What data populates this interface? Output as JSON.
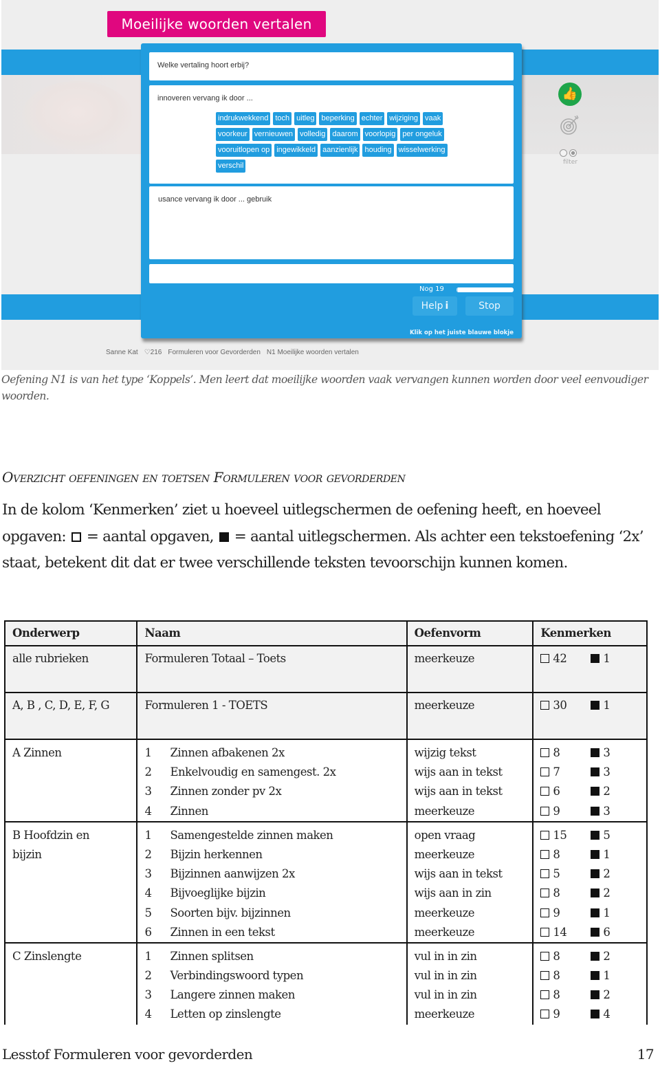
{
  "screenshot": {
    "exercise_title": "Moeilijke woorden vertalen",
    "question": "Welke vertaling hoort erbij?",
    "prompt": "innoveren vervang ik door ...",
    "word_chips": [
      "indrukwekkend",
      "toch",
      "uitleg",
      "beperking",
      "echter",
      "wijziging",
      "vaak",
      "voorkeur",
      "vernieuwen",
      "volledig",
      "daarom",
      "voorlopig",
      "per ongeluk",
      "vooruitlopen op",
      "ingewikkeld",
      "aanzienlijk",
      "houding",
      "wisselwerking",
      "verschil"
    ],
    "previous_answer": "usance vervang ik door ... gebruik",
    "input_value": "",
    "remaining_label": "Nog 19",
    "progress_fraction": 0.02,
    "help_label": "Help",
    "help_icon": "info-icon",
    "stop_label": "Stop",
    "hint": "Klik op het juiste blauwe blokje",
    "side_icons": [
      "thumbs-up-icon",
      "target-icon"
    ],
    "filter_label": "filter",
    "status_bar": {
      "user": "Sanne Kat",
      "hearts": "♡216",
      "course": "Formuleren voor Gevorderden",
      "exercise": "N1 Moeilijke woorden vertalen"
    },
    "colors": {
      "panel_blue": "#219ddf",
      "title_pink": "#e0077f",
      "thumb_green": "#1ea54a"
    }
  },
  "caption": "Oefening N1 is van het type ‘Koppels’. Men leert dat moeilijke woorden vaak vervangen kunnen worden door veel eenvoudiger woorden.",
  "heading": {
    "part1_cap": "O",
    "part1_rest": "verzicht oefeningen en toetsen ",
    "part2_cap": "F",
    "part2_rest": "ormuleren voor gevorderden"
  },
  "intro": {
    "before": "In de kolom ‘Kenmerken’ ziet u hoeveel uitlegschermen de oefening heeft, en hoeveel opgaven: ",
    "open_square_meaning": " = aantal opgaven, ",
    "filled_square_meaning": " = aantal uitlegschermen. Als achter een tekstoefening ‘2x’ staat, betekent dit dat er twee verschillende teksten tevoorschijn kunnen komen."
  },
  "table": {
    "headers": [
      "Onderwerp",
      "Naam",
      "Oefenvorm",
      "Kenmerken"
    ],
    "tests": [
      {
        "onderwerp": "alle rubrieken",
        "naam": "Formuleren Totaal – Toets",
        "oefenvorm": "meerkeuze",
        "opgaven": "42",
        "uitleg": "1"
      },
      {
        "onderwerp": "A, B , C, D, E, F, G",
        "naam": "Formuleren 1 - TOETS",
        "oefenvorm": "meerkeuze",
        "opgaven": "30",
        "uitleg": "1"
      }
    ],
    "groups": [
      {
        "onderwerp": [
          "A Zinnen"
        ],
        "items": [
          {
            "nr": "1",
            "naam": "Zinnen afbakenen 2x",
            "oefenvorm": "wijzig tekst",
            "opgaven": "8",
            "uitleg": "3"
          },
          {
            "nr": "2",
            "naam": "Enkelvoudig en samengest. 2x",
            "oefenvorm": "wijs aan in tekst",
            "opgaven": "7",
            "uitleg": "3"
          },
          {
            "nr": "3",
            "naam": "Zinnen zonder pv 2x",
            "oefenvorm": "wijs aan in tekst",
            "opgaven": "6",
            "uitleg": "2"
          },
          {
            "nr": "4",
            "naam": "Zinnen",
            "oefenvorm": "meerkeuze",
            "opgaven": "9",
            "uitleg": "3"
          }
        ]
      },
      {
        "onderwerp": [
          "B Hoofdzin en",
          "bijzin"
        ],
        "items": [
          {
            "nr": "1",
            "naam": "Samengestelde zinnen maken",
            "oefenvorm": "open vraag",
            "opgaven": "15",
            "uitleg": "5"
          },
          {
            "nr": "2",
            "naam": "Bijzin herkennen",
            "oefenvorm": "meerkeuze",
            "opgaven": "8",
            "uitleg": "1"
          },
          {
            "nr": "3",
            "naam": "Bijzinnen aanwijzen 2x",
            "oefenvorm": "wijs aan in tekst",
            "opgaven": "5",
            "uitleg": "2"
          },
          {
            "nr": "4",
            "naam": "Bijvoeglijke bijzin",
            "oefenvorm": "wijs aan in zin",
            "opgaven": "8",
            "uitleg": "2"
          },
          {
            "nr": "5",
            "naam": "Soorten bijv. bijzinnen",
            "oefenvorm": "meerkeuze",
            "opgaven": "9",
            "uitleg": "1"
          },
          {
            "nr": "6",
            "naam": "Zinnen in een tekst",
            "oefenvorm": "meerkeuze",
            "opgaven": "14",
            "uitleg": "6"
          }
        ]
      },
      {
        "onderwerp": [
          "C Zinslengte"
        ],
        "items": [
          {
            "nr": "1",
            "naam": "Zinnen splitsen",
            "oefenvorm": "vul in in zin",
            "opgaven": "8",
            "uitleg": "2"
          },
          {
            "nr": "2",
            "naam": "Verbindingswoord typen",
            "oefenvorm": "vul in in zin",
            "opgaven": "8",
            "uitleg": "1"
          },
          {
            "nr": "3",
            "naam": "Langere zinnen maken",
            "oefenvorm": "vul in in zin",
            "opgaven": "8",
            "uitleg": "2"
          },
          {
            "nr": "4",
            "naam": "Letten op zinslengte",
            "oefenvorm": "meerkeuze",
            "opgaven": "9",
            "uitleg": "4"
          }
        ]
      }
    ]
  },
  "footer": {
    "title": "Lesstof Formuleren voor gevorderden",
    "page": "17"
  }
}
